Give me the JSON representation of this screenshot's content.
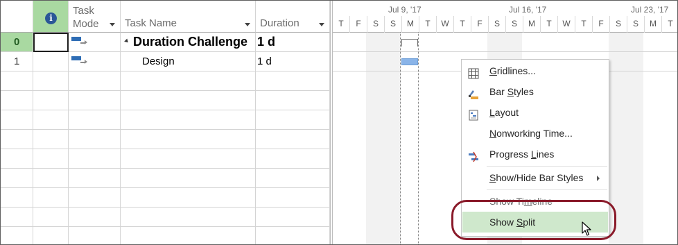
{
  "table": {
    "headers": {
      "info_icon": "i",
      "task_mode_line1": "Task",
      "task_mode_line2": "Mode",
      "task_name": "Task Name",
      "duration": "Duration"
    },
    "rows": [
      {
        "id": "0",
        "name": "Duration Challenge",
        "duration": "1 d"
      },
      {
        "id": "1",
        "name": "Design",
        "duration": "1 d"
      }
    ]
  },
  "timeline": {
    "weeks": [
      "Jul 9, '17",
      "Jul 16, '17",
      "Jul 23, '17"
    ],
    "days": [
      "T",
      "F",
      "S",
      "S",
      "M",
      "T",
      "W",
      "T",
      "F",
      "S",
      "S",
      "M",
      "T",
      "W",
      "T",
      "F",
      "S",
      "S",
      "M",
      "T"
    ]
  },
  "context_menu": {
    "items": [
      {
        "pre": "",
        "ul": "G",
        "post": "ridlines...",
        "icon": "gridlines-icon"
      },
      {
        "pre": "Bar ",
        "ul": "S",
        "post": "tyles",
        "icon": "bar-styles-icon"
      },
      {
        "pre": "",
        "ul": "L",
        "post": "ayout",
        "icon": "layout-icon"
      },
      {
        "pre": "",
        "ul": "N",
        "post": "onworking Time...",
        "icon": ""
      },
      {
        "pre": "Progress ",
        "ul": "L",
        "post": "ines",
        "icon": "progress-lines-icon"
      },
      {
        "pre": "",
        "ul": "S",
        "post": "how/Hide Bar Styles",
        "icon": ""
      },
      {
        "pre": "Show Ti",
        "ul": "m",
        "post": "eline",
        "icon": ""
      },
      {
        "pre": "Show ",
        "ul": "S",
        "post": "plit",
        "icon": ""
      }
    ]
  }
}
